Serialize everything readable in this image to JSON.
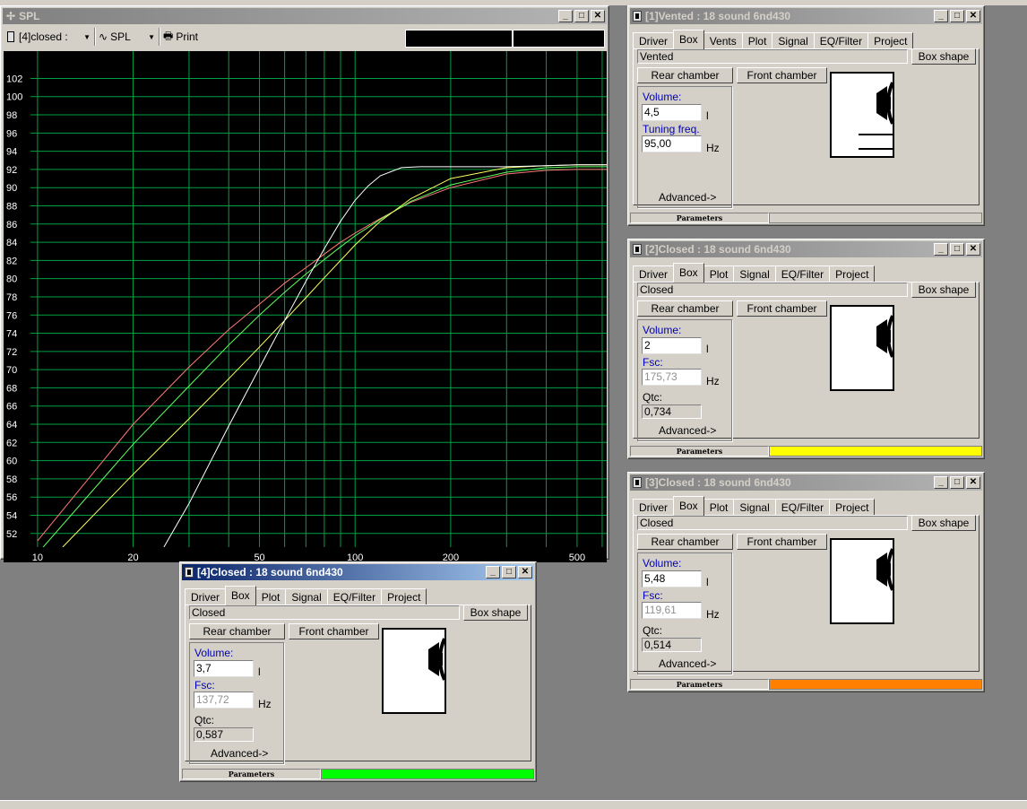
{
  "spl_window": {
    "title": "SPL",
    "toolbar": {
      "box_select": "[4]closed :",
      "plot_select": "SPL",
      "print_label": "Print"
    }
  },
  "chart_data": {
    "type": "line",
    "xscale": "log",
    "xlim": [
      9.5,
      620
    ],
    "ylim": [
      50.5,
      105
    ],
    "xticks": [
      10,
      20,
      50,
      100,
      200,
      500
    ],
    "xtick_labels": [
      "10",
      "20",
      "50",
      "100",
      "200",
      "500"
    ],
    "xgrid": [
      10,
      20,
      30,
      40,
      50,
      60,
      70,
      80,
      90,
      100,
      200,
      300,
      400,
      500,
      600
    ],
    "yticks": [
      52,
      54,
      56,
      58,
      60,
      62,
      64,
      66,
      68,
      70,
      72,
      74,
      76,
      78,
      80,
      82,
      84,
      86,
      88,
      90,
      92,
      94,
      96,
      98,
      100,
      102
    ],
    "grid": true,
    "series": [
      {
        "color": "#ff7878",
        "x": [
          10,
          20,
          30,
          40,
          50,
          60,
          70,
          80,
          90,
          100,
          120,
          150,
          200,
          300,
          400,
          500,
          620
        ],
        "y": [
          51.2,
          64.0,
          70.3,
          74.4,
          77.2,
          79.5,
          81.2,
          82.7,
          84.0,
          85.0,
          86.6,
          88.4,
          90.0,
          91.5,
          91.9,
          92.0,
          92.0
        ]
      },
      {
        "color": "#60ff60",
        "x": [
          10,
          20,
          30,
          40,
          50,
          60,
          70,
          80,
          90,
          100,
          120,
          150,
          200,
          300,
          400,
          500,
          620
        ],
        "y": [
          49.8,
          61.8,
          68.2,
          72.7,
          76.0,
          78.5,
          80.5,
          82.1,
          83.5,
          84.7,
          86.5,
          88.5,
          90.3,
          91.7,
          92.2,
          92.3,
          92.3
        ]
      },
      {
        "color": "#ffff60",
        "x": [
          12,
          20,
          30,
          40,
          50,
          60,
          70,
          80,
          90,
          100,
          120,
          150,
          200,
          300,
          400,
          500,
          620
        ],
        "y": [
          50.5,
          58.5,
          64.6,
          69.0,
          72.5,
          75.4,
          77.9,
          80.1,
          82.0,
          83.7,
          86.3,
          88.8,
          91.0,
          92.2,
          92.4,
          92.5,
          92.5
        ]
      },
      {
        "color": "#ffffff",
        "x": [
          25,
          30,
          40,
          50,
          60,
          70,
          80,
          90,
          100,
          110,
          120,
          140,
          160,
          200,
          300,
          400,
          500,
          620
        ],
        "y": [
          50.5,
          55.3,
          63.8,
          70.2,
          75.4,
          79.7,
          83.3,
          86.3,
          88.6,
          90.2,
          91.3,
          92.2,
          92.3,
          92.3,
          92.3,
          92.4,
          92.5,
          92.5
        ]
      }
    ]
  },
  "windows": [
    {
      "title": "[1]Vented : 18 sound 6nd430",
      "active": false,
      "tabs": [
        "Driver",
        "Box",
        "Vents",
        "Plot",
        "Signal",
        "EQ/Filter",
        "Project"
      ],
      "box_type": "Vented",
      "box_shape_label": "Box shape",
      "rear_chamber_label": "Rear chamber",
      "front_chamber_label": "Front chamber",
      "volume_label": "Volume:",
      "volume_value": "4,5",
      "volume_unit": "l",
      "freq_label": "Tuning freq.",
      "freq_value": "95,00",
      "freq_unit": "Hz",
      "advanced_label": "Advanced->",
      "parameters_label": "Parameters",
      "bar_color": "#d4d0c8"
    },
    {
      "title": "[2]Closed : 18 sound 6nd430",
      "active": false,
      "tabs": [
        "Driver",
        "Box",
        "Plot",
        "Signal",
        "EQ/Filter",
        "Project"
      ],
      "box_type": "Closed",
      "box_shape_label": "Box shape",
      "rear_chamber_label": "Rear chamber",
      "front_chamber_label": "Front chamber",
      "volume_label": "Volume:",
      "volume_value": "2",
      "volume_unit": "l",
      "freq_label": "Fsc:",
      "freq_value": "175,73",
      "freq_unit": "Hz",
      "qtc_label": "Qtc:",
      "qtc_value": "0,734",
      "advanced_label": "Advanced->",
      "parameters_label": "Parameters",
      "bar_color": "#ffff00"
    },
    {
      "title": "[3]Closed : 18 sound 6nd430",
      "active": false,
      "tabs": [
        "Driver",
        "Box",
        "Plot",
        "Signal",
        "EQ/Filter",
        "Project"
      ],
      "box_type": "Closed",
      "box_shape_label": "Box shape",
      "rear_chamber_label": "Rear chamber",
      "front_chamber_label": "Front chamber",
      "volume_label": "Volume:",
      "volume_value": "5,48",
      "volume_unit": "l",
      "freq_label": "Fsc:",
      "freq_value": "119,61",
      "freq_unit": "Hz",
      "qtc_label": "Qtc:",
      "qtc_value": "0,514",
      "advanced_label": "Advanced->",
      "parameters_label": "Parameters",
      "bar_color": "#ff8000"
    },
    {
      "title": "[4]Closed : 18 sound 6nd430",
      "active": true,
      "tabs": [
        "Driver",
        "Box",
        "Plot",
        "Signal",
        "EQ/Filter",
        "Project"
      ],
      "box_type": "Closed",
      "box_shape_label": "Box shape",
      "rear_chamber_label": "Rear chamber",
      "front_chamber_label": "Front chamber",
      "volume_label": "Volume:",
      "volume_value": "3,7",
      "volume_unit": "l",
      "freq_label": "Fsc:",
      "freq_value": "137,72",
      "freq_unit": "Hz",
      "qtc_label": "Qtc:",
      "qtc_value": "0,587",
      "advanced_label": "Advanced->",
      "parameters_label": "Parameters",
      "bar_color": "#00ff00"
    }
  ]
}
